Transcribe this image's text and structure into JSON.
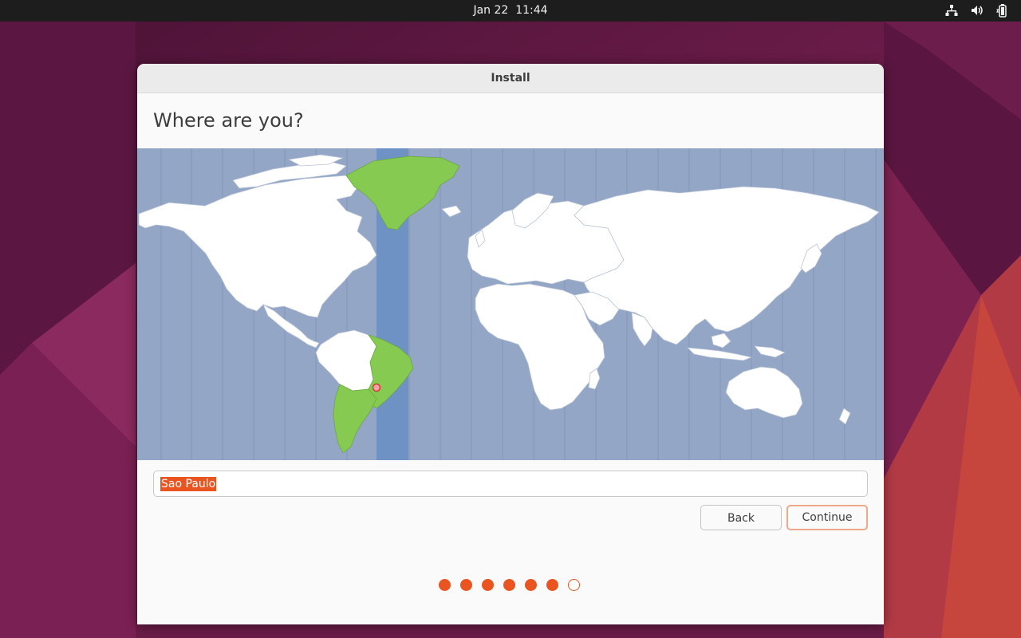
{
  "topbar": {
    "date": "Jan 22",
    "time": "11:44",
    "icons": [
      "network-icon",
      "volume-icon",
      "battery-icon"
    ]
  },
  "window": {
    "title": "Install"
  },
  "page": {
    "heading": "Where are you?"
  },
  "map": {
    "selected_city": "Sao Paulo",
    "highlighted_region": "South America / Greenland timezone band",
    "colors": {
      "ocean": "#93a6c6",
      "land": "#ffffff",
      "highlight": "#86ca52",
      "band": "#6e92c4",
      "marker": "#e95420"
    }
  },
  "location": {
    "value": "Sao Paulo"
  },
  "buttons": {
    "back": "Back",
    "continue": "Continue"
  },
  "progress": {
    "total": 7,
    "completed": 6
  },
  "colors": {
    "accent": "#e95420",
    "window_bg": "#fafafa",
    "titlebar_bg": "#ebebeb",
    "topbar_bg": "#1d1d1d"
  }
}
